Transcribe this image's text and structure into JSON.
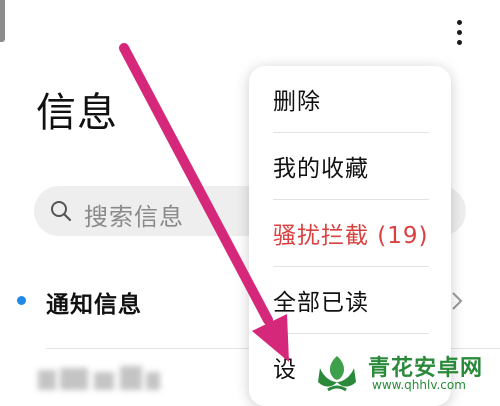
{
  "header": {
    "title": "信息",
    "more_icon": "more-vertical-icon"
  },
  "search": {
    "placeholder": "搜索信息",
    "icon": "search-icon"
  },
  "list": {
    "notice_label": "通知信息"
  },
  "menu": {
    "items": [
      {
        "label": "删除"
      },
      {
        "label": "我的收藏"
      },
      {
        "label": "骚扰拦截 (19)"
      },
      {
        "label": "全部已读"
      },
      {
        "label": "设"
      }
    ]
  },
  "watermark": {
    "name": "青花安卓网",
    "url": "www.qhhlv.com"
  },
  "colors": {
    "accent_blue": "#1e8ae6",
    "danger_red": "#d8413f",
    "arrow_magenta": "#d6287a",
    "watermark_green": "#2a8a3a"
  }
}
